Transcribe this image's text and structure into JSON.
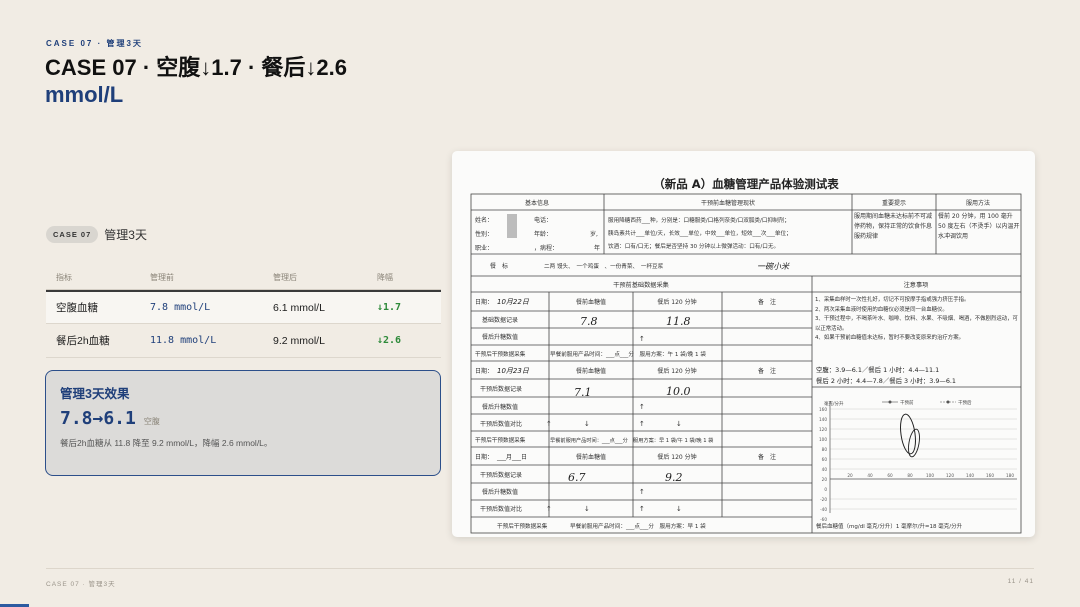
{
  "slide": {
    "eyebrow": "CASE 07 · 管理3天",
    "headline": "CASE 07 · 空腹↓1.7 · 餐后↓2.6",
    "headline_unit": "mmol/L",
    "chip": "CASE 07",
    "chip_text": "管理3天",
    "accent_color": "#1f3f7a",
    "positive_color": "#2e8a3a"
  },
  "table": {
    "headers": [
      "指标",
      "管理前",
      "管理后",
      "降幅"
    ],
    "rows": [
      {
        "name": "空腹血糖",
        "before": "7.8 mmol/L",
        "after": "6.1 mmol/L",
        "drop": "↓1.7"
      },
      {
        "name": "餐后2h血糖",
        "before": "11.8 mmol/L",
        "after": "9.2 mmol/L",
        "drop": "↓2.6"
      }
    ]
  },
  "effect": {
    "title": "管理3天效果",
    "value": "7.8→6.1",
    "tag": "空腹",
    "desc": "餐后2h血糖从 11.8 降至 9.2 mmol/L，降幅 2.6 mmol/L。"
  },
  "form": {
    "title": "（新品 A）血糖管理产品体验测试表",
    "sec_basic": "基本信息",
    "sec_status": "干预前血糖管理现状",
    "sec_tips": "重要提示",
    "sec_usage": "服用方法",
    "basic_line1": "姓名：",
    "basic_line1b": "电话：",
    "basic_line2": "性别：",
    "basic_line2b": "年龄：",
    "basic_line2c": "岁,",
    "basic_line3": "职业：",
    "basic_line3b": "，病程：",
    "basic_line3c": "年",
    "status_line1": "服用降糖西药___种，分别是：口糖服类/口格列奈类/口双胍类/口抑制剂；",
    "status_line2": "胰岛素共计___单位/天，长效___单位，中效___单位，短效___次___单位；",
    "status_line3": "饮酒：口有/口无；餐后是否坚持 30 分钟以上微弹活动：口有/口无。",
    "tips_text": "服用期间血糖未达标前不可减停药物，保持正常的饮食作息服药规律",
    "usage_text": "餐前 20 分钟，用 100 毫升 50 度左右（不烫手）以内温开水冲调饮用",
    "meal_label": "餐　标",
    "meal_items": "二两 馒头、　一个鸡蛋　、一份青菜、　一杯豆浆",
    "meal_note": "一碗小米",
    "sec_pre": "干预前基础数据采集",
    "sec_notes": "注意事项",
    "date_label": "日期：",
    "date1": "10月22日",
    "date2": "10月23日",
    "date3": "___月___日",
    "col_fasting": "餐前血糖值",
    "col_post": "餐后 120 分钟",
    "col_remark": "备　注",
    "row_base": "基础数据记录",
    "row_rise": "餐后升糖数值",
    "row_after": "干预后数据记录",
    "row_compare": "干预后数值对比",
    "collect_line": "干预后干预数据采集",
    "collect_detail": "早餐前服用产品时间：___点___分　服用方案：午 1 袋/晚 1 袋",
    "collect_detail2": "早餐前服用产品时间：___点___分　服用方案：早 1 袋/午 1 袋/晚 1 袋",
    "collect_detail3": "早餐前服用产品时间：___点___分　服用方案：早 1 袋",
    "h_pre_fasting": "7.8",
    "h_pre_post": "11.8",
    "h_d2_fasting": "7.1",
    "h_d2_post": "10.0",
    "h_d3_fasting": "6.7",
    "h_d3_post": "9.2",
    "notes_1": "1、采集血样时一次性扎好，切记不可按摩手指或强力挤压手指。",
    "notes_2": "2、两次采集血液时使用的血糖仪必须是同一台血糖仪。",
    "notes_3": "3、干预过程中，不喝茶叶水、咖啡、饮料、水果、不吸烟、喝酒，不做剧烈运动，可以正常活动。",
    "notes_4": "4、如果干预前血糖值未达标，暂时不要改变原来的治疗方案。",
    "ref_1": "空腹：3.9—6.1／餐后 1 小时：4.4—11.1",
    "ref_2": "餐后 2 小时：4.4—7.8／餐后 3 小时：3.9—6.1",
    "chart_ylabel": "毫克/分升",
    "legend_pre": "干预前",
    "legend_post": "干预后",
    "chart_yticks": [
      "160",
      "140",
      "120",
      "100",
      "80",
      "60",
      "40",
      "20",
      "0",
      "-20",
      "-40",
      "-60"
    ],
    "chart_xticks": [
      "20",
      "40",
      "60",
      "80",
      "100",
      "120",
      "140",
      "160",
      "180"
    ],
    "footnote": "餐后血糖值（mg/dl 毫克/分升）1 毫摩尔/升=18 毫克/分升"
  },
  "footer": {
    "left": "CASE 07 · 管理3天",
    "right": "11 / 41",
    "progress_fraction": 0.027
  }
}
